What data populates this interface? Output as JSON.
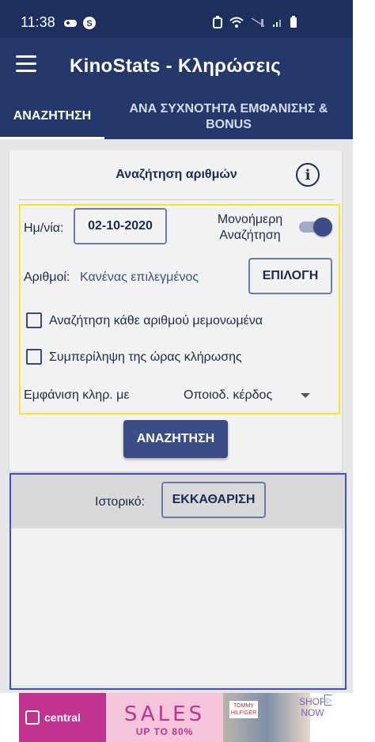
{
  "status_bar": {
    "time": "11:38"
  },
  "app_bar": {
    "title": "KinoStats - Κληρώσεις"
  },
  "tabs": [
    {
      "label": "ΑΝΑΖΗΤΗΣΗ",
      "selected": true
    },
    {
      "label": "ΑΝΑ ΣΥΧΝΟΤΗΤΑ ΕΜΦΑΝΙΣΗΣ & BONUS",
      "selected": false
    }
  ],
  "search_card": {
    "title": "Αναζήτηση αριθμών",
    "date_label": "Ημ/νία:",
    "date_value": "02-10-2020",
    "single_day_label": "Μονοήμερη Αναζήτηση",
    "single_day_on": true,
    "numbers_label": "Αριθμοί:",
    "numbers_value": "Κανένας επιλεγμένος",
    "select_button": "ΕΠΙΛΟΓΗ",
    "checkbox_each": "Αναζήτηση κάθε αριθμού μεμονωμένα",
    "checkbox_each_checked": false,
    "checkbox_time": "Συμπερίληψη της ώρας κλήρωσης",
    "checkbox_time_checked": false,
    "show_label": "Εμφάνιση κληρ. με",
    "show_dropdown_value": "Οποιοδ. κέρδος",
    "search_button": "ΑΝΑΖΗΤΗΣΗ"
  },
  "history": {
    "label": "Ιστορικό:",
    "clear_button": "ΕΚΚΑΘΑΡΙΣΗ"
  },
  "ad": {
    "brand": "central",
    "headline": "SALES",
    "subline": "UP TO 80%",
    "product_brand": "TOMMY HILFIGER",
    "cta": "SHOP NOW"
  },
  "colors": {
    "status_bar": "#1c2f5e",
    "app_bar": "#24386b",
    "accent": "#3c4c86",
    "highlight_yellow": "#f5e531",
    "highlight_blue": "#3f4bd4"
  }
}
